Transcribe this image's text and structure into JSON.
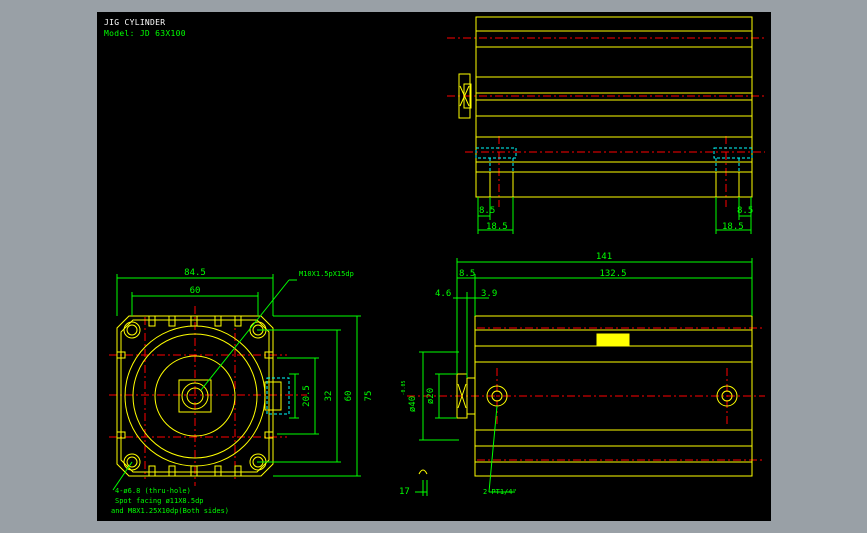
{
  "header": {
    "title": "JIG CYLINDER",
    "model": "Model: JD 63X100"
  },
  "dimensions": {
    "top_left_8_5": "8.5",
    "top_left_18_5": "18.5",
    "top_right_8_5": "8.5",
    "top_right_18_5": "18.5",
    "front_width_outer": "84.5",
    "front_width_inner": "60",
    "thread_note": "M10X1.5pX15dp",
    "dim_20_5": "20.5",
    "dim_32": "32",
    "dim_60": "60",
    "dim_75": "75",
    "side_total": "141",
    "side_8_5": "8.5",
    "side_132_5": "132.5",
    "side_4_6": "4.6",
    "side_3_9": "3.9",
    "side_phi40": "ø40",
    "side_phi40_tol": "-0.05",
    "side_phi20": "ø20",
    "side_17": "17",
    "port_note": "2-PT1/4\""
  },
  "notes": {
    "hole_note_1": "4-ø6.8 (thru-hole)",
    "hole_note_2": "Spot facing ø11X8.5dp",
    "hole_note_3": "and M8X1.25X10dp(Both sides)"
  },
  "colors": {
    "background": "#000000",
    "frame": "#99a0a6",
    "outline": "#ffff00",
    "dimension": "#00ff00",
    "centerline": "#ff0000",
    "hidden": "#00ffff"
  }
}
